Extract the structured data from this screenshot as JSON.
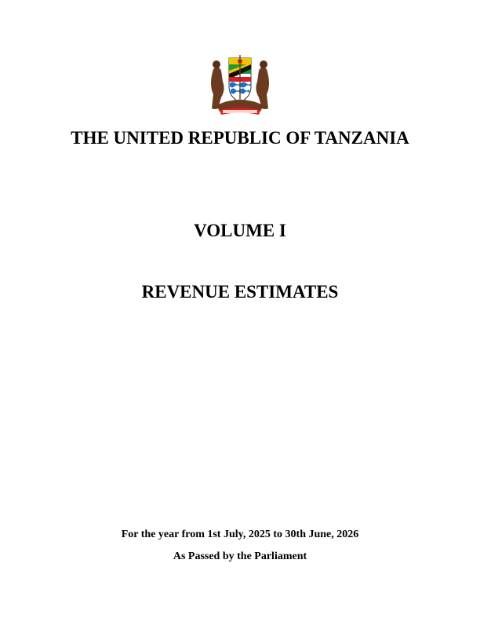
{
  "document": {
    "emblem_icon": "tanzania-coat-of-arms-icon",
    "country": "THE UNITED REPUBLIC OF TANZANIA",
    "volume": "VOLUME I",
    "subject": "REVENUE ESTIMATES",
    "period": "For the year from 1st July, 2025 to 30th June, 2026",
    "status": "As Passed by the Parliament"
  },
  "colors": {
    "text": "#000000",
    "background": "#ffffff",
    "emblem_green": "#1a9a3a",
    "emblem_blue": "#1e6fc9",
    "emblem_yellow": "#f2c500",
    "emblem_red": "#d42020",
    "emblem_brown": "#6b3a1f"
  }
}
